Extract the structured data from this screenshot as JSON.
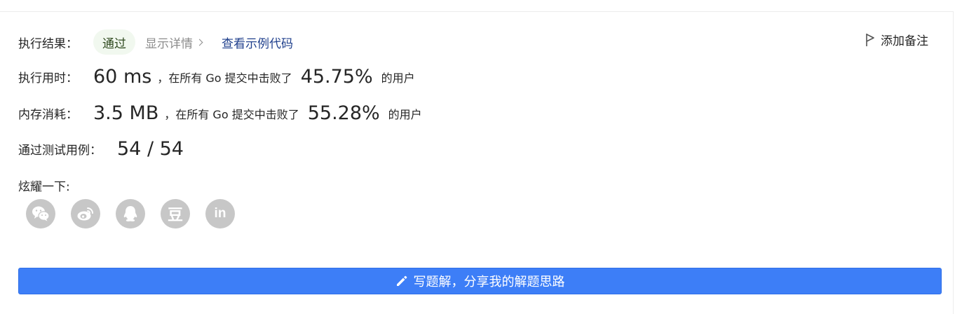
{
  "result": {
    "label": "执行结果：",
    "status": "通过",
    "details_link": "显示详情",
    "sample_link": "查看示例代码"
  },
  "note_button": "添加备注",
  "runtime": {
    "label": "执行用时：",
    "value": "60 ms",
    "beat_prefix": "，在所有 Go 提交中击败了",
    "percent": "45.75%",
    "suffix": "的用户"
  },
  "memory": {
    "label": "内存消耗：",
    "value": "3.5 MB",
    "beat_prefix": "，在所有 Go 提交中击败了",
    "percent": "55.28%",
    "suffix": "的用户"
  },
  "testcases": {
    "label": "通过测试用例：",
    "value": "54 / 54"
  },
  "share": {
    "label": "炫耀一下:",
    "icons": [
      "wechat-icon",
      "weibo-icon",
      "qq-icon",
      "douban-icon",
      "linkedin-icon"
    ],
    "douban_glyph": "豆",
    "linkedin_glyph": "in"
  },
  "write_button": "写题解，分享我的解题思路",
  "colors": {
    "accent_blue": "#3d7ef7",
    "status_green_bg": "#f1f8ef",
    "link_blue": "#1f3f8c",
    "share_icon_bg": "#c7c7c7"
  }
}
